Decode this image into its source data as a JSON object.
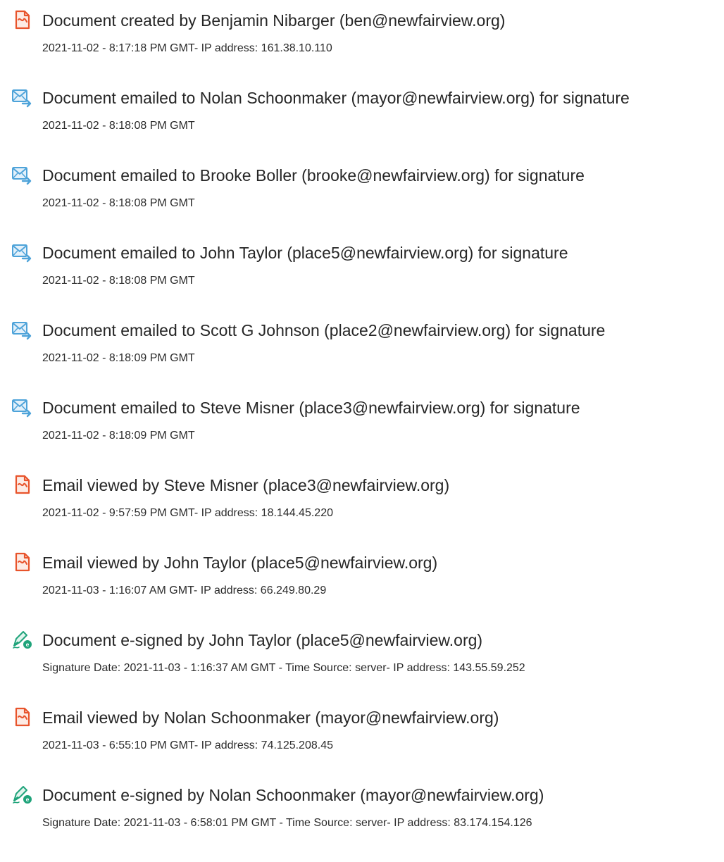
{
  "entries": [
    {
      "icon": "document-created-icon",
      "title": "Document created by Benjamin Nibarger (ben@newfairview.org)",
      "meta": "2021-11-02 - 8:17:18 PM GMT- IP address: 161.38.10.110"
    },
    {
      "icon": "document-emailed-icon",
      "title": "Document emailed to Nolan Schoonmaker (mayor@newfairview.org) for signature",
      "meta": "2021-11-02 - 8:18:08 PM GMT"
    },
    {
      "icon": "document-emailed-icon",
      "title": "Document emailed to Brooke Boller (brooke@newfairview.org) for signature",
      "meta": "2021-11-02 - 8:18:08 PM GMT"
    },
    {
      "icon": "document-emailed-icon",
      "title": "Document emailed to John Taylor (place5@newfairview.org) for signature",
      "meta": "2021-11-02 - 8:18:08 PM GMT"
    },
    {
      "icon": "document-emailed-icon",
      "title": "Document emailed to Scott G Johnson (place2@newfairview.org) for signature",
      "meta": "2021-11-02 - 8:18:09 PM GMT"
    },
    {
      "icon": "document-emailed-icon",
      "title": "Document emailed to Steve Misner (place3@newfairview.org) for signature",
      "meta": "2021-11-02 - 8:18:09 PM GMT"
    },
    {
      "icon": "email-viewed-icon",
      "title": "Email viewed by Steve Misner (place3@newfairview.org)",
      "meta": "2021-11-02 - 9:57:59 PM GMT- IP address: 18.144.45.220"
    },
    {
      "icon": "email-viewed-icon",
      "title": "Email viewed by John Taylor (place5@newfairview.org)",
      "meta": "2021-11-03 - 1:16:07 AM GMT- IP address: 66.249.80.29"
    },
    {
      "icon": "e-signed-icon",
      "title": "Document e-signed by John Taylor (place5@newfairview.org)",
      "meta": "Signature Date: 2021-11-03 - 1:16:37 AM GMT - Time Source: server- IP address: 143.55.59.252"
    },
    {
      "icon": "email-viewed-icon",
      "title": "Email viewed by Nolan Schoonmaker (mayor@newfairview.org)",
      "meta": "2021-11-03 - 6:55:10 PM GMT- IP address: 74.125.208.45"
    },
    {
      "icon": "e-signed-icon",
      "title": "Document e-signed by Nolan Schoonmaker (mayor@newfairview.org)",
      "meta": "Signature Date: 2021-11-03 - 6:58:01 PM GMT - Time Source: server- IP address: 83.174.154.126"
    }
  ],
  "colors": {
    "document_icon": "#e8542c",
    "email_icon": "#4ea3d9",
    "signature_icon": "#1fa37a",
    "text": "#262626"
  }
}
